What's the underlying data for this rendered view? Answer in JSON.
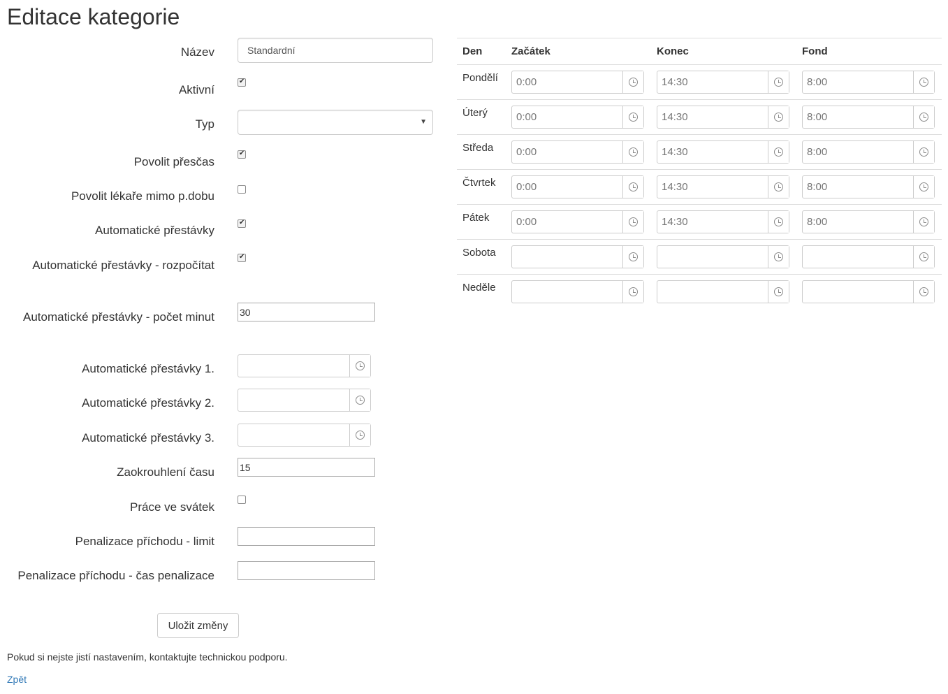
{
  "page": {
    "title": "Editace kategorie"
  },
  "form": {
    "name_label": "Název",
    "name_value": "Standardní",
    "active_label": "Aktivní",
    "active_checked": true,
    "type_label": "Typ",
    "type_value": "",
    "overtime_label": "Povolit přesčas",
    "overtime_checked": true,
    "doctor_label": "Povolit lékaře mimo p.dobu",
    "doctor_checked": false,
    "auto_breaks_label": "Automatické přestávky",
    "auto_breaks_checked": true,
    "auto_breaks_split_label": "Automatické přestávky - rozpočítat",
    "auto_breaks_split_checked": true,
    "auto_breaks_minutes_label": "Automatické přestávky - počet minut",
    "auto_breaks_minutes_value": "30",
    "auto_break1_label": "Automatické přestávky 1.",
    "auto_break1_value": "",
    "auto_break2_label": "Automatické přestávky 2.",
    "auto_break2_value": "",
    "auto_break3_label": "Automatické přestávky 3.",
    "auto_break3_value": "",
    "rounding_label": "Zaokrouhlení času",
    "rounding_value": "15",
    "holiday_work_label": "Práce ve svátek",
    "holiday_work_checked": false,
    "penalty_limit_label": "Penalizace příchodu - limit",
    "penalty_limit_value": "",
    "penalty_time_label": "Penalizace příchodu - čas penalizace",
    "penalty_time_value": "",
    "save_button": "Uložit změny"
  },
  "schedule": {
    "headers": [
      "Den",
      "Začátek",
      "Konec",
      "Fond"
    ],
    "rows": [
      {
        "day": "Pondělí",
        "start": "0:00",
        "end": "14:30",
        "fund": "8:00"
      },
      {
        "day": "Úterý",
        "start": "0:00",
        "end": "14:30",
        "fund": "8:00"
      },
      {
        "day": "Středa",
        "start": "0:00",
        "end": "14:30",
        "fund": "8:00"
      },
      {
        "day": "Čtvrtek",
        "start": "0:00",
        "end": "14:30",
        "fund": "8:00"
      },
      {
        "day": "Pátek",
        "start": "0:00",
        "end": "14:30",
        "fund": "8:00"
      },
      {
        "day": "Sobota",
        "start": "",
        "end": "",
        "fund": ""
      },
      {
        "day": "Neděle",
        "start": "",
        "end": "",
        "fund": ""
      }
    ]
  },
  "footer": {
    "note": "Pokud si nejste jistí nastavením, kontaktujte technickou podporu.",
    "back_link": "Zpět"
  }
}
